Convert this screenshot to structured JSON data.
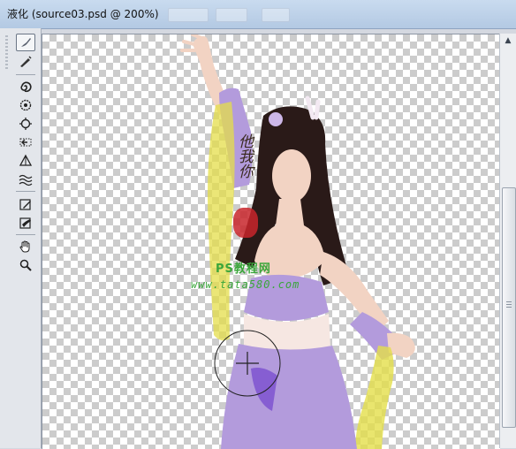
{
  "window": {
    "title": "液化 (source03.psd @ 200%)"
  },
  "toolbar": {
    "tools": [
      {
        "name": "forward-warp-tool",
        "icon": "warp-brush-icon",
        "active": true
      },
      {
        "name": "reconstruct-tool",
        "icon": "reconstruct-brush-icon",
        "active": false
      },
      {
        "name": "twirl-clockwise-tool",
        "icon": "twirl-icon",
        "active": false
      },
      {
        "name": "pucker-tool",
        "icon": "pucker-icon",
        "active": false
      },
      {
        "name": "bloat-tool",
        "icon": "bloat-icon",
        "active": false
      },
      {
        "name": "push-left-tool",
        "icon": "push-left-icon",
        "active": false
      },
      {
        "name": "mirror-tool",
        "icon": "mirror-icon",
        "active": false
      },
      {
        "name": "turbulence-tool",
        "icon": "turbulence-icon",
        "active": false
      },
      {
        "name": "freeze-mask-tool",
        "icon": "freeze-mask-icon",
        "active": false
      },
      {
        "name": "thaw-mask-tool",
        "icon": "thaw-mask-icon",
        "active": false
      },
      {
        "name": "hand-tool",
        "icon": "hand-icon",
        "active": false
      },
      {
        "name": "zoom-tool",
        "icon": "zoom-icon",
        "active": false
      }
    ]
  },
  "watermark": {
    "vertical_text": "他我你",
    "site_name": "PS教程网",
    "url": "www.tata580.com"
  },
  "colors": {
    "costume": "#b39bdc",
    "sleeve": "#e4de4a",
    "hair": "#2a1a18",
    "skin": "#f2d3c3"
  }
}
